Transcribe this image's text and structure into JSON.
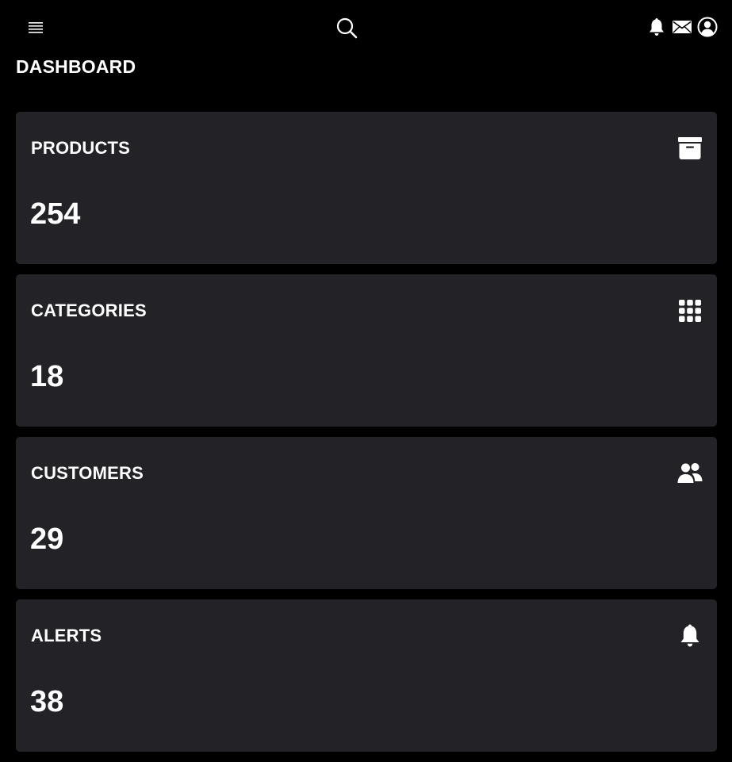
{
  "page": {
    "title": "DASHBOARD"
  },
  "topbar": {
    "icons": [
      "menu-icon",
      "search-icon",
      "bell-icon",
      "mail-icon",
      "user-circle-icon"
    ]
  },
  "cards": [
    {
      "label": "PRODUCTS",
      "value": "254",
      "icon": "archive-icon"
    },
    {
      "label": "CATEGORIES",
      "value": "18",
      "icon": "grid-icon"
    },
    {
      "label": "CUSTOMERS",
      "value": "29",
      "icon": "people-icon"
    },
    {
      "label": "ALERTS",
      "value": "38",
      "icon": "bell-icon"
    }
  ],
  "colors": {
    "background": "#000000",
    "card": "#232226",
    "text": "#ffffff"
  }
}
